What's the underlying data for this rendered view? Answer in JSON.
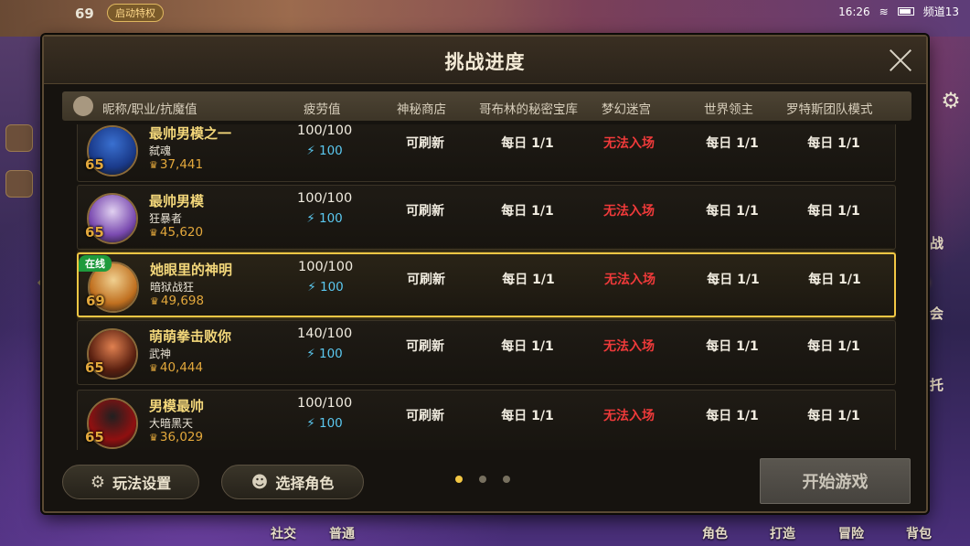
{
  "status": {
    "time": "16:26",
    "channel": "频道13"
  },
  "hud": {
    "level": "69",
    "badge": "启动特权"
  },
  "dialog": {
    "title": "挑战进度",
    "columns": [
      "昵称/职业/抗魔值",
      "疲劳值",
      "神秘商店",
      "哥布林的秘密宝库",
      "梦幻迷宫",
      "世界领主",
      "罗特斯团队模式"
    ],
    "rows": [
      {
        "name": "最帅男模之一",
        "job": "弑魂",
        "power": "37,441",
        "level": "65",
        "fatigue": "100/100",
        "energy": "100",
        "shop": "可刷新",
        "goblin": "每日 1/1",
        "maze": "无法入场",
        "lord": "每日 1/1",
        "rotes": "每日 1/1",
        "online": ""
      },
      {
        "name": "最帅男模",
        "job": "狂暴者",
        "power": "45,620",
        "level": "65",
        "fatigue": "100/100",
        "energy": "100",
        "shop": "可刷新",
        "goblin": "每日 1/1",
        "maze": "无法入场",
        "lord": "每日 1/1",
        "rotes": "每日 1/1",
        "online": ""
      },
      {
        "name": "她眼里的神明",
        "job": "暗狱战狂",
        "power": "49,698",
        "level": "69",
        "fatigue": "100/100",
        "energy": "100",
        "shop": "可刷新",
        "goblin": "每日 1/1",
        "maze": "无法入场",
        "lord": "每日 1/1",
        "rotes": "每日 1/1",
        "online": "在线"
      },
      {
        "name": "萌萌拳击败你",
        "job": "武神",
        "power": "40,444",
        "level": "65",
        "fatigue": "140/100",
        "energy": "100",
        "shop": "可刷新",
        "goblin": "每日 1/1",
        "maze": "无法入场",
        "lord": "每日 1/1",
        "rotes": "每日 1/1",
        "online": ""
      },
      {
        "name": "男模最帅",
        "job": "大暗黑天",
        "power": "36,029",
        "level": "65",
        "fatigue": "100/100",
        "energy": "100",
        "shop": "可刷新",
        "goblin": "每日 1/1",
        "maze": "无法入场",
        "lord": "每日 1/1",
        "rotes": "每日 1/1",
        "online": ""
      }
    ],
    "footer": {
      "settings_label": "玩法设置",
      "select_role_label": "选择角色",
      "start_label": "开始游戏",
      "page_count": 3,
      "page_active": 1
    }
  },
  "bottom_nav": [
    "社交",
    "普通",
    "角色",
    "打造",
    "冒险",
    "背包"
  ],
  "side_labels": [
    "战",
    "会",
    "托"
  ],
  "colors": {
    "accent_gold": "#f2c744",
    "danger_red": "#ef3a3a",
    "energy_blue": "#5bc8f0",
    "name_gold": "#f3d77a"
  },
  "icons": [
    "close-icon",
    "gear-icon",
    "character-icon",
    "lightning-icon",
    "crown-icon",
    "chevron-right-icon",
    "chevron-left-icon"
  ]
}
